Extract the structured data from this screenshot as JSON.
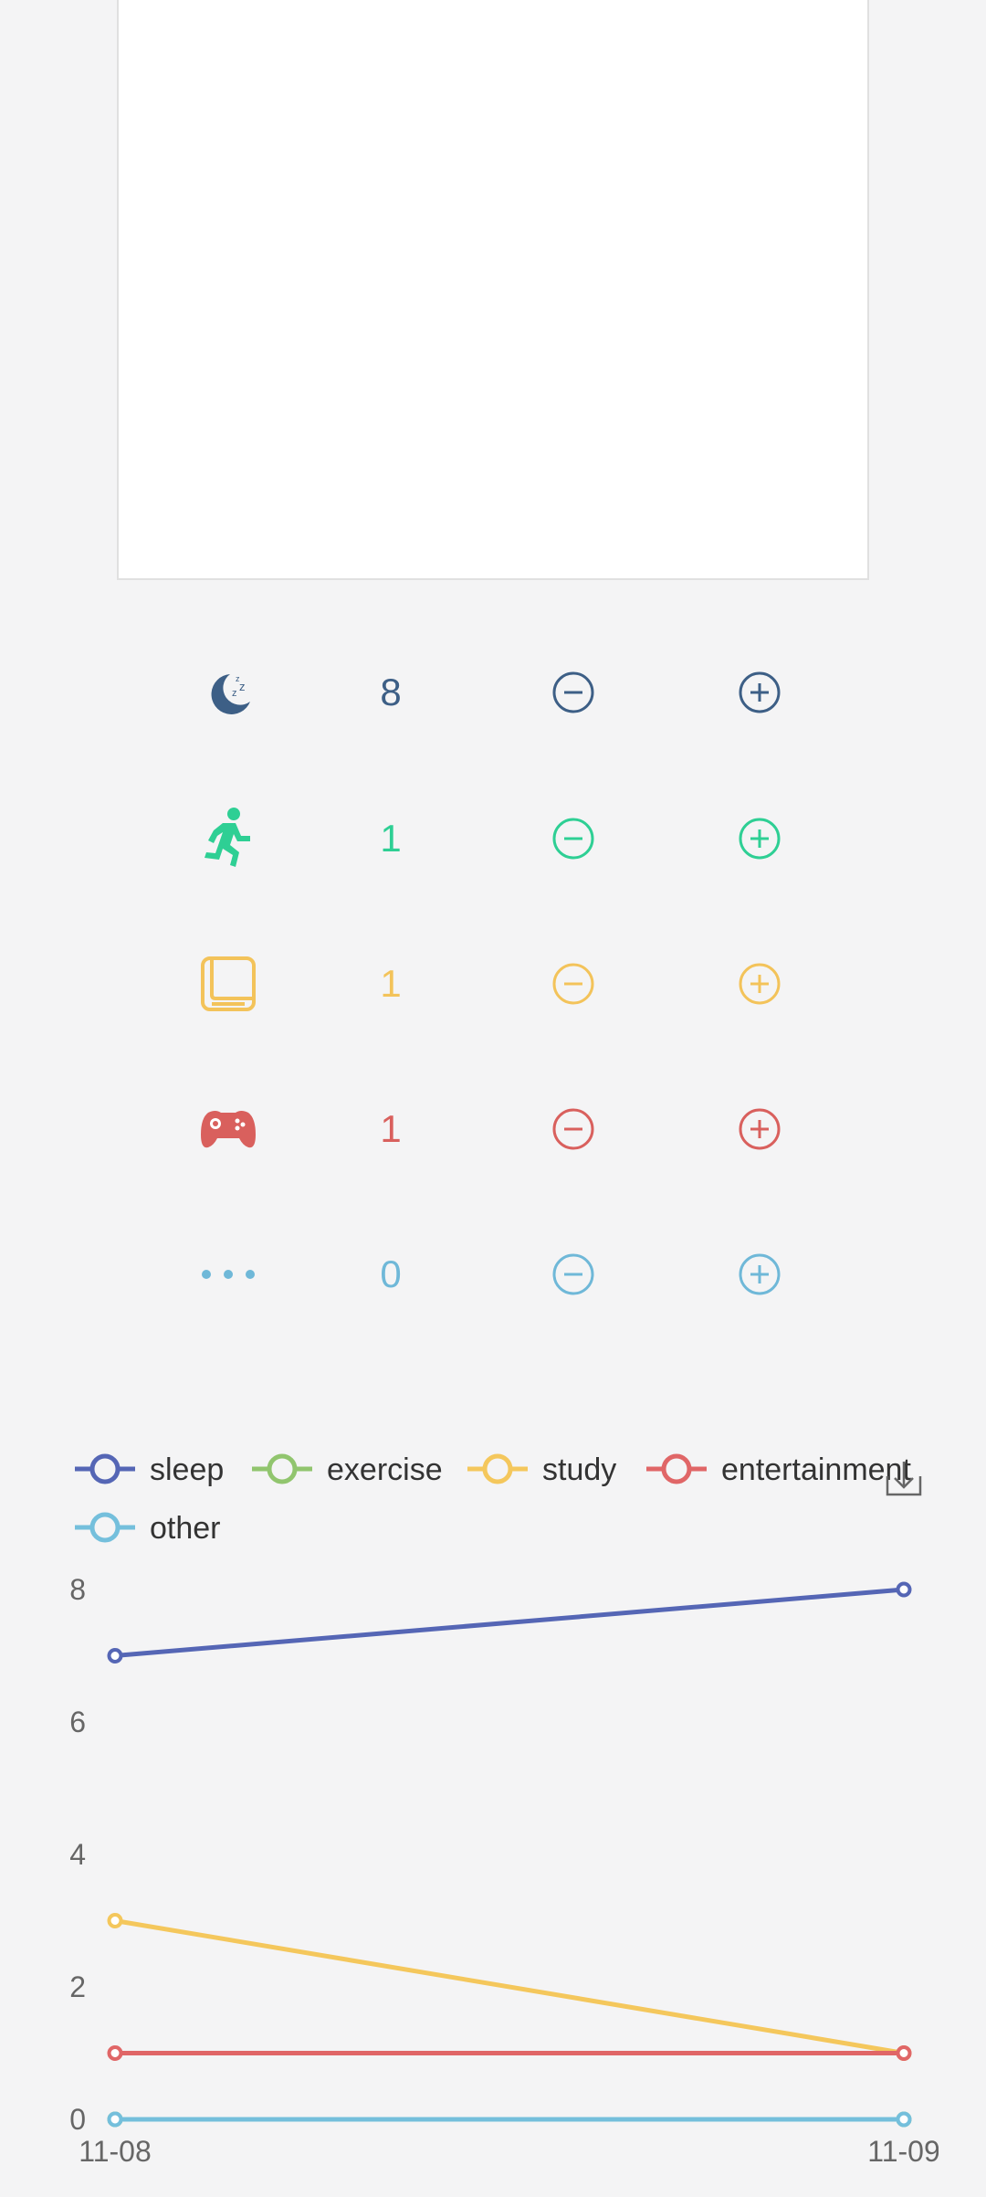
{
  "activities": [
    {
      "key": "sleep",
      "icon": "moon-sleep-icon",
      "count": "8",
      "color": "#3d5f86"
    },
    {
      "key": "exercise",
      "icon": "running-person-icon",
      "count": "1",
      "color": "#2ecf94"
    },
    {
      "key": "study",
      "icon": "book-icon",
      "count": "1",
      "color": "#f3c35a"
    },
    {
      "key": "entertainment",
      "icon": "gamepad-icon",
      "count": "1",
      "color": "#d9605d"
    },
    {
      "key": "other",
      "icon": "more-dots-icon",
      "count": "0",
      "color": "#6fb8d8"
    }
  ],
  "chart_data": {
    "type": "line",
    "x": [
      "11-08",
      "11-09"
    ],
    "tick_labels_shown": [
      "11-08",
      "11-0"
    ],
    "ylim": [
      0,
      8
    ],
    "yticks": [
      "0",
      "2",
      "4",
      "6",
      "8"
    ],
    "series": [
      {
        "name": "sleep",
        "values": [
          7,
          8
        ],
        "color": "#5566b5"
      },
      {
        "name": "exercise",
        "values": [
          0,
          0
        ],
        "color": "#91c56e"
      },
      {
        "name": "study",
        "values": [
          3,
          1
        ],
        "color": "#f4c75c"
      },
      {
        "name": "entertainment",
        "values": [
          1,
          1
        ],
        "color": "#e06667"
      },
      {
        "name": "other",
        "values": [
          0,
          0
        ],
        "color": "#74bfdc"
      }
    ],
    "legend_position": "top",
    "download_icon": "download-icon"
  }
}
